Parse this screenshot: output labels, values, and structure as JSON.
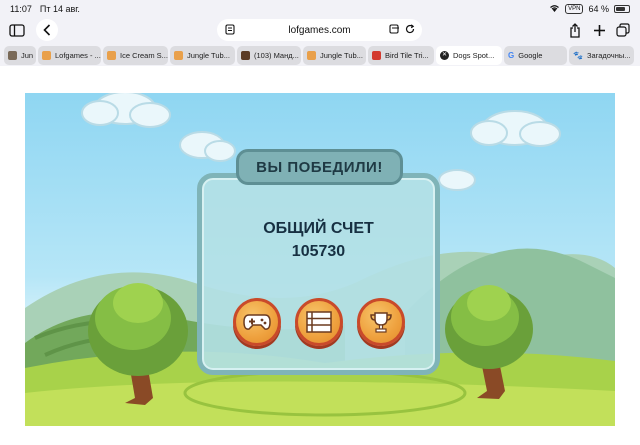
{
  "status": {
    "time": "11:07",
    "date": "Пт 14 авг.",
    "vpn": "VPN",
    "battery": "64 %"
  },
  "toolbar": {
    "url": "lofgames.com"
  },
  "tabs": [
    {
      "label": "Jun",
      "color": "#7a6a58"
    },
    {
      "label": "Lofgames - ...",
      "color": "#e9a04a"
    },
    {
      "label": "Ice Cream S...",
      "color": "#e9a04a"
    },
    {
      "label": "Jungle Tub...",
      "color": "#e9a04a"
    },
    {
      "label": "(103) Манд...",
      "color": "#5b3b25"
    },
    {
      "label": "Jungle Tub...",
      "color": "#e9a04a"
    },
    {
      "label": "Bird Tile Tri...",
      "color": "#d33a2f"
    },
    {
      "label": "Dogs Spot...",
      "color": "#333333",
      "active": true
    },
    {
      "label": "Google",
      "color": "#4285f4"
    },
    {
      "label": "Загадочны...",
      "color": "#222222"
    }
  ],
  "game": {
    "title": "ВЫ ПОБЕДИЛИ!",
    "score_label": "ОБЩИЙ СЧЕТ",
    "score_value": "105730",
    "buttons": [
      "play-button",
      "menu-button",
      "trophy-button"
    ]
  }
}
